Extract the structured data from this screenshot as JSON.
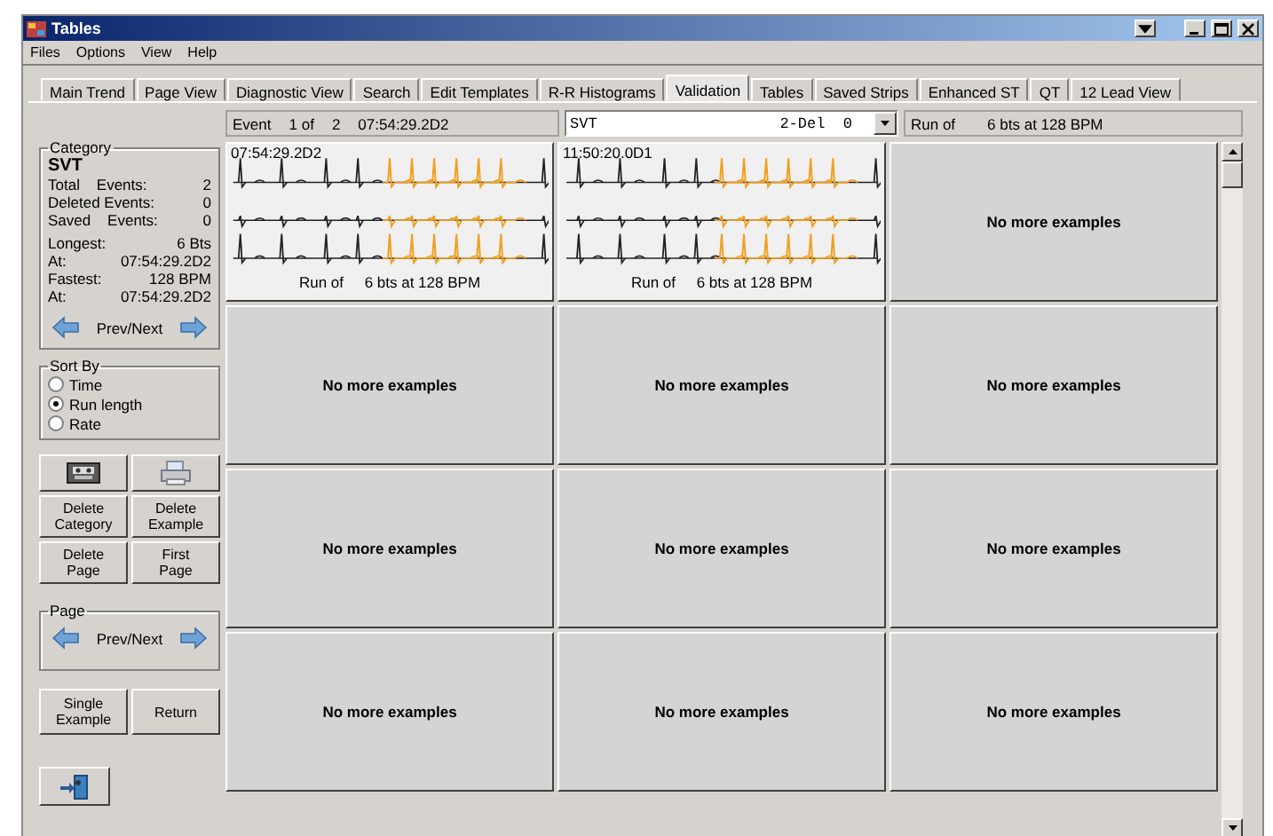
{
  "window": {
    "title": "Tables"
  },
  "menu": [
    "Files",
    "Options",
    "View",
    "Help"
  ],
  "tabs": [
    {
      "label": "Main Trend",
      "selected": false
    },
    {
      "label": "Page View",
      "selected": false
    },
    {
      "label": "Diagnostic View",
      "selected": false
    },
    {
      "label": "Search",
      "selected": false
    },
    {
      "label": "Edit Templates",
      "selected": false
    },
    {
      "label": "R-R Histograms",
      "selected": false
    },
    {
      "label": "Validation",
      "selected": true
    },
    {
      "label": "Tables",
      "selected": false
    },
    {
      "label": "Saved Strips",
      "selected": false
    },
    {
      "label": "Enhanced ST",
      "selected": false
    },
    {
      "label": "QT",
      "selected": false
    },
    {
      "label": "12 Lead View",
      "selected": false
    }
  ],
  "category": {
    "legend": "Category",
    "name": "SVT",
    "stats": [
      {
        "label": "Total    Events:",
        "value": "2"
      },
      {
        "label": "Deleted Events:",
        "value": "0"
      },
      {
        "label": "Saved    Events:",
        "value": "0"
      }
    ],
    "details": [
      {
        "label": "Longest:",
        "value": "6 Bts"
      },
      {
        "label": "At:",
        "value": "07:54:29.2D2"
      },
      {
        "label": "Fastest:",
        "value": "128 BPM"
      },
      {
        "label": "At:",
        "value": "07:54:29.2D2"
      }
    ],
    "nav": "Prev/Next"
  },
  "sort": {
    "legend": "Sort By",
    "options": [
      {
        "label": "Time",
        "selected": false
      },
      {
        "label": "Run length",
        "selected": true
      },
      {
        "label": "Rate",
        "selected": false
      }
    ]
  },
  "buttons": [
    "Delete Category",
    "Delete Example",
    "Delete Page",
    "First Page"
  ],
  "page": {
    "legend": "Page",
    "nav": "Prev/Next"
  },
  "bottom_buttons": [
    "Single Example",
    "Return"
  ],
  "header": {
    "event_label": "Event",
    "index": "1 of",
    "total": "2",
    "time": "07:54:29.2D2",
    "dropdown_name": "SVT",
    "dropdown_value": "2-Del  0",
    "run_label": "Run of",
    "run_value": "6 bts at 128 BPM"
  },
  "cells": [
    {
      "kind": "strip",
      "time": "07:54:29.2D2",
      "caption": "Run of     6 bts at 128 BPM"
    },
    {
      "kind": "strip",
      "time": "11:50:20.0D1",
      "caption": "Run of     6 bts at 128 BPM"
    },
    {
      "kind": "empty",
      "text": "No more examples"
    },
    {
      "kind": "empty",
      "text": "No more examples"
    },
    {
      "kind": "empty",
      "text": "No more examples"
    },
    {
      "kind": "empty",
      "text": "No more examples"
    },
    {
      "kind": "empty",
      "text": "No more examples"
    },
    {
      "kind": "empty",
      "text": "No more examples"
    },
    {
      "kind": "empty",
      "text": "No more examples"
    },
    {
      "kind": "empty",
      "text": "No more examples"
    },
    {
      "kind": "empty",
      "text": "No more examples"
    },
    {
      "kind": "empty",
      "text": "No more examples"
    }
  ]
}
